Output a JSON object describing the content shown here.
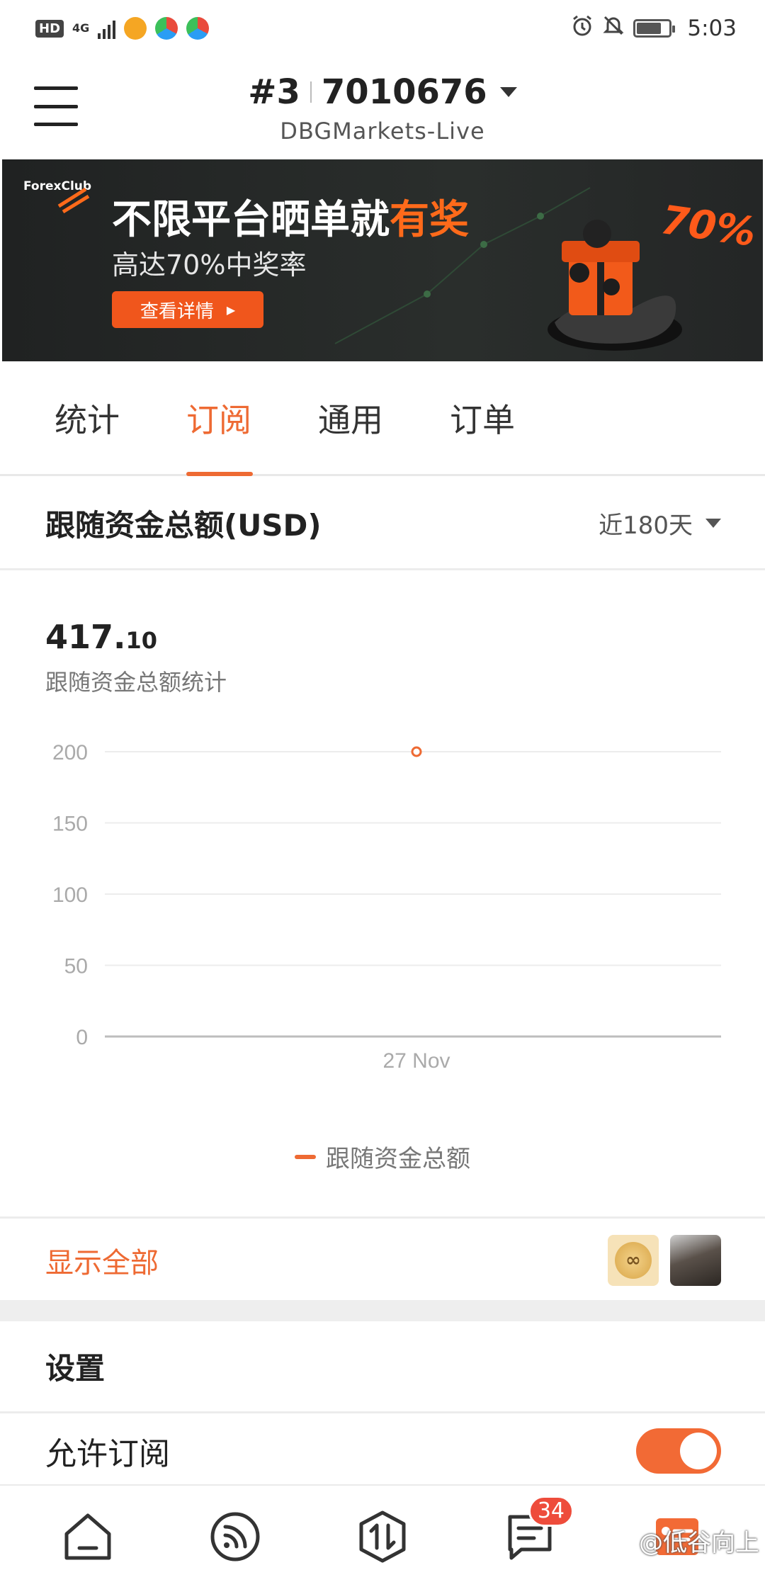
{
  "status_bar": {
    "hd": "HD",
    "network": "4G",
    "time": "5:03"
  },
  "header": {
    "account_index": "#3",
    "account_number": "7010676",
    "server": "DBGMarkets-Live"
  },
  "banner": {
    "brand": "ForexClub",
    "title_main": "不限平台晒单就",
    "title_highlight": "有奖",
    "subtitle": "高达70%中奖率",
    "button_label": "查看详情",
    "badge_text": "70%"
  },
  "tabs": [
    {
      "label": "统计",
      "active": false
    },
    {
      "label": "订阅",
      "active": true
    },
    {
      "label": "通用",
      "active": false
    },
    {
      "label": "订单",
      "active": false
    }
  ],
  "section": {
    "title": "跟随资金总额(USD)",
    "range_label": "近180天"
  },
  "summary": {
    "value_int": "417.",
    "value_dec": "10",
    "label": "跟随资金总额统计"
  },
  "chart_data": {
    "type": "line",
    "x": [
      "27 Nov"
    ],
    "series": [
      {
        "name": "跟随资金总额",
        "values": [
          200
        ]
      }
    ],
    "yticks": [
      200,
      150,
      100,
      50,
      0
    ],
    "ylim": [
      0,
      200
    ],
    "grid": true,
    "legend_position": "bottom",
    "color": "#ee6a33"
  },
  "show_all": {
    "label": "显示全部"
  },
  "settings": {
    "title": "设置",
    "allow_subscription_label": "允许订阅",
    "allow_subscription_on": true
  },
  "bottom_nav": {
    "items": [
      {
        "icon": "home-icon"
      },
      {
        "icon": "signals-icon"
      },
      {
        "icon": "trade-icon"
      },
      {
        "icon": "messages-icon",
        "badge": "34"
      },
      {
        "icon": "profile-icon"
      }
    ]
  },
  "watermark": "@低谷向上",
  "colors": {
    "accent": "#ee6a33",
    "banner_bg": "#202222",
    "badge": "#ee4c3b"
  }
}
